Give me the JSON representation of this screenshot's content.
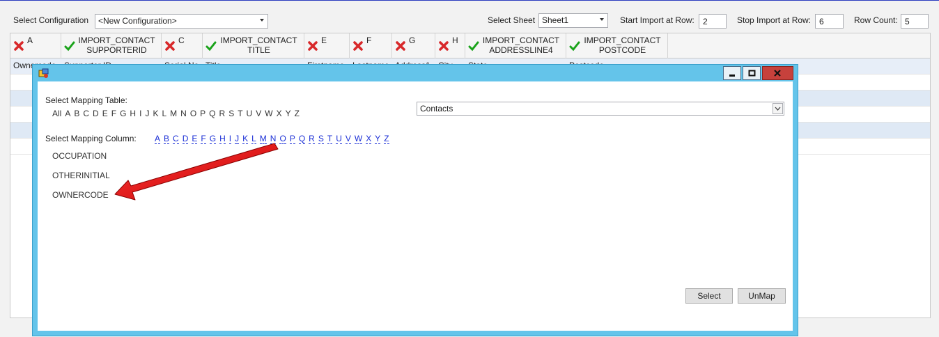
{
  "toolbar": {
    "select_configuration_label": "Select Configuration",
    "configuration_value": "<New Configuration>",
    "select_sheet_label": "Select Sheet",
    "sheet_value": "Sheet1",
    "start_import_label": "Start Import at Row:",
    "start_import_value": "2",
    "stop_import_label": "Stop Import at Row:",
    "stop_import_value": "6",
    "row_count_label": "Row Count:",
    "row_count_value": "5"
  },
  "grid": {
    "columns": [
      {
        "status": "unmapped",
        "line1": "A",
        "line2": ""
      },
      {
        "status": "mapped",
        "line1": "IMPORT_CONTACT",
        "line2": "SUPPORTERID"
      },
      {
        "status": "unmapped",
        "line1": "C",
        "line2": ""
      },
      {
        "status": "mapped",
        "line1": "IMPORT_CONTACT",
        "line2": "TITLE"
      },
      {
        "status": "unmapped",
        "line1": "E",
        "line2": ""
      },
      {
        "status": "unmapped",
        "line1": "F",
        "line2": ""
      },
      {
        "status": "unmapped",
        "line1": "G",
        "line2": ""
      },
      {
        "status": "unmapped",
        "line1": "H",
        "line2": ""
      },
      {
        "status": "mapped",
        "line1": "IMPORT_CONTACT",
        "line2": "ADDRESSLINE4"
      },
      {
        "status": "mapped",
        "line1": "IMPORT_CONTACT",
        "line2": "POSTCODE"
      }
    ],
    "first_row": [
      "Ownercode",
      "Supporter ID",
      "Serial No",
      "Title",
      "Firstname",
      "Lastname",
      "Address1",
      "City",
      "State",
      "Postcode"
    ]
  },
  "dialog": {
    "select_table_label": "Select Mapping Table:",
    "table_letters": [
      "All",
      "A",
      "B",
      "C",
      "D",
      "E",
      "F",
      "G",
      "H",
      "I",
      "J",
      "K",
      "L",
      "M",
      "N",
      "O",
      "P",
      "Q",
      "R",
      "S",
      "T",
      "U",
      "V",
      "W",
      "X",
      "Y",
      "Z"
    ],
    "table_value": "Contacts",
    "select_column_label": "Select Mapping Column:",
    "column_letters": [
      "A",
      "B",
      "C",
      "D",
      "E",
      "F",
      "G",
      "H",
      "I",
      "J",
      "K",
      "L",
      "M",
      "N",
      "O",
      "P",
      "Q",
      "R",
      "S",
      "T",
      "U",
      "V",
      "W",
      "X",
      "Y",
      "Z"
    ],
    "columns": [
      "OCCUPATION",
      "OTHERINITIAL",
      "OWNERCODE"
    ],
    "select_button": "Select",
    "unmap_button": "UnMap"
  },
  "colors": {
    "dialog_frame": "#64c4ea",
    "link_blue": "#1b2fd6",
    "mapped_check": "#1aa31a",
    "unmapped_x": "#d8282a",
    "annotation_arrow": "#e01010"
  }
}
